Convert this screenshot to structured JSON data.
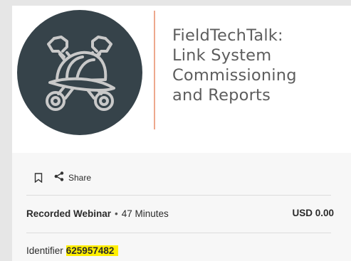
{
  "banner": {
    "logo_icon": "wrenches-and-hardhat-icon",
    "title_lines": [
      "FieldTechTalk:",
      "Link System",
      "Commissioning",
      "and Reports"
    ]
  },
  "actions": {
    "bookmark_icon": "bookmark-icon",
    "share_icon": "share-icon",
    "share_label": "Share"
  },
  "meta": {
    "type": "Recorded Webinar",
    "separator": "•",
    "duration": "47 Minutes",
    "price": "USD 0.00"
  },
  "identifier": {
    "label": "Identifier",
    "value": "625957482"
  },
  "colors": {
    "logo_circle": "#36434a",
    "accent_divider": "#eda88d",
    "highlight": "#ffef00"
  }
}
